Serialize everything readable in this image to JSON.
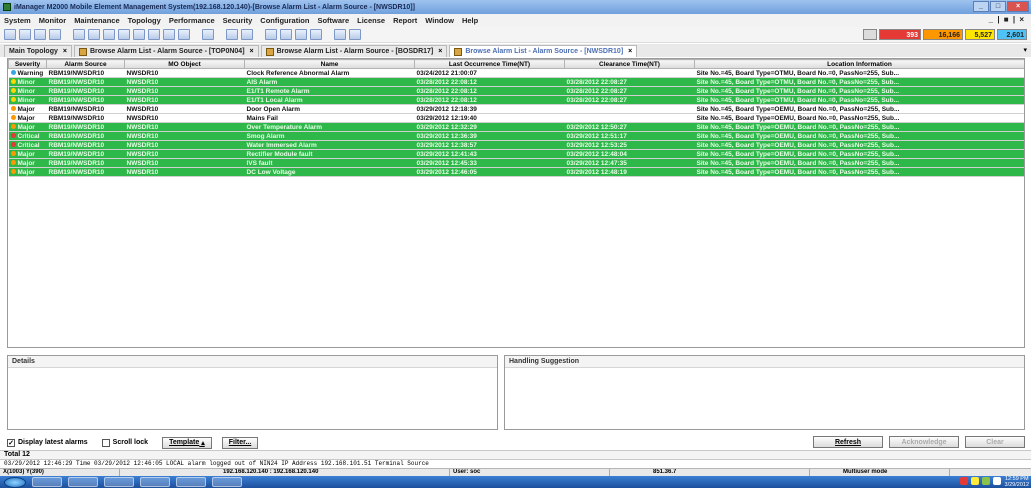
{
  "window": {
    "title": "iManager M2000 Mobile Element Management System(192.168.120.140)-[Browse Alarm List - Alarm Source - [NWSDR10]]",
    "controls": [
      "_",
      "□",
      "×"
    ]
  },
  "menu": {
    "items": [
      "System",
      "Monitor",
      "Maintenance",
      "Topology",
      "Performance",
      "Security",
      "Configuration",
      "Software",
      "License",
      "Report",
      "Window",
      "Help"
    ],
    "mdi_controls": "_ | ■ | ×"
  },
  "alarm_counters": [
    "",
    "393",
    "16,166",
    "5,527",
    "2,601"
  ],
  "tabs": [
    {
      "label": "Main Topology",
      "active": false
    },
    {
      "label": "Browse Alarm List - Alarm Source - [TOP0N04]",
      "active": false
    },
    {
      "label": "Browse Alarm List - Alarm Source - [BOSDR17]",
      "active": false
    },
    {
      "label": "Browse Alarm List - Alarm Source - [NWSDR10]",
      "active": true
    }
  ],
  "grid": {
    "columns": [
      "Severity",
      "Alarm Source",
      "MO Object",
      "Name",
      "Last Occurrence Time(NT)",
      "Clearance Time(NT)",
      "Location Information"
    ],
    "rows": [
      {
        "severity": "Warning",
        "sev_class": "warning",
        "source": "RBM19/NWSDR10",
        "mo": "NWSDR10",
        "name": "Clock Reference Abnormal Alarm",
        "last": "03/24/2012 21:00:07",
        "clear": "",
        "location": "Site No.=45, Board Type=OTMU, Board No.=0, PassNo=255, Sub...",
        "style": "white"
      },
      {
        "severity": "Minor",
        "sev_class": "minor",
        "source": "RBM19/NWSDR10",
        "mo": "NWSDR10",
        "name": "AIS Alarm",
        "last": "03/28/2012 22:08:12",
        "clear": "03/28/2012 22:08:27",
        "location": "Site No.=45, Board Type=OTMU, Board No.=0, PassNo=255, Sub...",
        "style": "green"
      },
      {
        "severity": "Minor",
        "sev_class": "minor",
        "source": "RBM19/NWSDR10",
        "mo": "NWSDR10",
        "name": "E1/T1 Remote Alarm",
        "last": "03/28/2012 22:08:12",
        "clear": "03/28/2012 22:08:27",
        "location": "Site No.=45, Board Type=OTMU, Board No.=0, PassNo=255, Sub...",
        "style": "green"
      },
      {
        "severity": "Minor",
        "sev_class": "minor",
        "source": "RBM19/NWSDR10",
        "mo": "NWSDR10",
        "name": "E1/T1 Local Alarm",
        "last": "03/28/2012 22:08:12",
        "clear": "03/28/2012 22:08:27",
        "location": "Site No.=45, Board Type=OTMU, Board No.=0, PassNo=255, Sub...",
        "style": "green"
      },
      {
        "severity": "Major",
        "sev_class": "major",
        "source": "RBM19/NWSDR10",
        "mo": "NWSDR10",
        "name": "Door Open Alarm",
        "last": "03/29/2012 12:18:39",
        "clear": "",
        "location": "Site No.=45, Board Type=OEMU, Board No.=0, PassNo=255, Sub...",
        "style": "white"
      },
      {
        "severity": "Major",
        "sev_class": "major",
        "source": "RBM19/NWSDR10",
        "mo": "NWSDR10",
        "name": "Mains Fail",
        "last": "03/29/2012 12:19:40",
        "clear": "",
        "location": "Site No.=45, Board Type=OEMU, Board No.=0, PassNo=255, Sub...",
        "style": "white"
      },
      {
        "severity": "Major",
        "sev_class": "major",
        "source": "RBM19/NWSDR10",
        "mo": "NWSDR10",
        "name": "Over Temperature Alarm",
        "last": "03/29/2012 12:32:29",
        "clear": "03/29/2012 12:50:27",
        "location": "Site No.=45, Board Type=OEMU, Board No.=0, PassNo=255, Sub...",
        "style": "green"
      },
      {
        "severity": "Critical",
        "sev_class": "critical",
        "source": "RBM19/NWSDR10",
        "mo": "NWSDR10",
        "name": "Smog Alarm",
        "last": "03/29/2012 12:36:39",
        "clear": "03/29/2012 12:51:17",
        "location": "Site No.=45, Board Type=OEMU, Board No.=0, PassNo=255, Sub...",
        "style": "green"
      },
      {
        "severity": "Critical",
        "sev_class": "critical",
        "source": "RBM19/NWSDR10",
        "mo": "NWSDR10",
        "name": "Water Immersed Alarm",
        "last": "03/29/2012 12:38:57",
        "clear": "03/29/2012 12:53:25",
        "location": "Site No.=45, Board Type=OEMU, Board No.=0, PassNo=255, Sub...",
        "style": "green"
      },
      {
        "severity": "Major",
        "sev_class": "major",
        "source": "RBM19/NWSDR10",
        "mo": "NWSDR10",
        "name": "Rectifier Module fault",
        "last": "03/29/2012 12:41:43",
        "clear": "03/29/2012 12:48:04",
        "location": "Site No.=45, Board Type=OEMU, Board No.=0, PassNo=255, Sub...",
        "style": "green"
      },
      {
        "severity": "Major",
        "sev_class": "major",
        "source": "RBM19/NWSDR10",
        "mo": "NWSDR10",
        "name": "IVS fault",
        "last": "03/29/2012 12:45:33",
        "clear": "03/29/2012 12:47:35",
        "location": "Site No.=45, Board Type=OEMU, Board No.=0, PassNo=255, Sub...",
        "style": "green"
      },
      {
        "severity": "Major",
        "sev_class": "major",
        "source": "RBM19/NWSDR10",
        "mo": "NWSDR10",
        "name": "DC Low Voltage",
        "last": "03/29/2012 12:46:05",
        "clear": "03/29/2012 12:48:19",
        "location": "Site No.=45, Board Type=OEMU, Board No.=0, PassNo=255, Sub...",
        "style": "green"
      }
    ]
  },
  "panels": {
    "details_title": "Details",
    "handling_title": "Handling Suggestion"
  },
  "controls": {
    "display_latest": "Display latest alarms",
    "scroll_lock": "Scroll lock",
    "template": "Template",
    "filter": "Filter...",
    "refresh": "Refresh",
    "acknowledge": "Acknowledge",
    "clear": "Clear"
  },
  "total": "Total 12",
  "message": "03/29/2012 12:46:29   Time 03/29/2012 12:46:05  LOCAL  alarm logged out of NIN24  IP Address 192.168.101.51  Terminal Source",
  "status": {
    "coords": "X(1003) Y(390)",
    "ip": "192.168.120.140 : 192.168.120.140",
    "user": "User: soc",
    "size": "851.36.7",
    "mode": "Multiuser mode"
  },
  "clock": {
    "time": "12:59 PM",
    "date": "3/29/2012"
  },
  "colors": {
    "cleared_row": "#2fb84a",
    "critical": "#e53935",
    "major": "#ff9800",
    "minor": "#ffd600",
    "warning": "#36a5ea"
  }
}
